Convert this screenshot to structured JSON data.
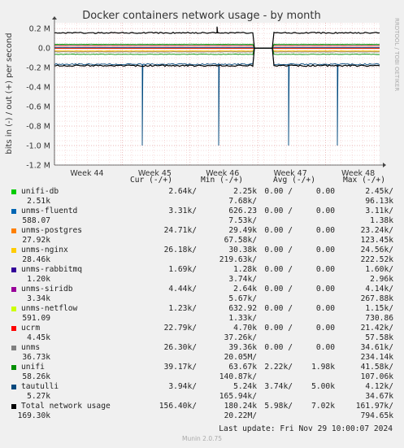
{
  "chart_data": {
    "type": "line",
    "title": "Docker containers network usage - by month",
    "ylabel": "bits in (-) / out (+) per second",
    "side_label": "RRDTOOL / TOBI OETIKER",
    "ylim": [
      -1200000,
      260000
    ],
    "y_ticks": [
      {
        "value": 200000,
        "label": "0.2 M"
      },
      {
        "value": 0,
        "label": "0.0"
      },
      {
        "value": -200000,
        "label": "-0.2 M"
      },
      {
        "value": -400000,
        "label": "-0.4 M"
      },
      {
        "value": -600000,
        "label": "-0.6 M"
      },
      {
        "value": -800000,
        "label": "-0.8 M"
      },
      {
        "value": -1000000,
        "label": "-1.0 M"
      },
      {
        "value": -1200000,
        "label": "-1.2 M"
      }
    ],
    "x_ticks": [
      "Week 44",
      "Week 45",
      "Week 46",
      "Week 47",
      "Week 48"
    ],
    "series": [
      {
        "name": "unifi-db",
        "color": "#00cc00",
        "out_level": 2640,
        "in_level": -2250
      },
      {
        "name": "unms-fluentd",
        "color": "#0066b3",
        "out_level": 3310,
        "in_level": -3310
      },
      {
        "name": "unms-postgres",
        "color": "#ff8000",
        "out_level": 24710,
        "in_level": -29490
      },
      {
        "name": "unms-nginx",
        "color": "#ffcc00",
        "out_level": 26180,
        "in_level": -30380
      },
      {
        "name": "unms-rabbitmq",
        "color": "#330099",
        "out_level": 1690,
        "in_level": -1280
      },
      {
        "name": "unms-siridb",
        "color": "#990099",
        "out_level": 4440,
        "in_level": -2640
      },
      {
        "name": "unms-netflow",
        "color": "#ccff00",
        "out_level": 1230,
        "in_level": -632
      },
      {
        "name": "ucrm",
        "color": "#ff0000",
        "out_level": 22790,
        "in_level": -4700
      },
      {
        "name": "unms",
        "color": "#808080",
        "out_level": 26300,
        "in_level": -39360
      },
      {
        "name": "unifi",
        "color": "#008f00",
        "out_level": 39170,
        "in_level": -63670
      },
      {
        "name": "tautulli",
        "color": "#00487d",
        "out_level": 3940,
        "in_level": -165940
      },
      {
        "name": "Total network usage",
        "color": "#000000",
        "out_level": 156400,
        "in_level": -180240
      }
    ]
  },
  "legend": {
    "headers": {
      "cur": "Cur (-/+)",
      "min": "Min (-/+)",
      "avg": "Avg (-/+)",
      "max": "Max (-/+)"
    },
    "rows": [
      {
        "name": "unifi-db",
        "color": "#00cc00",
        "cur_in": "2.64k/",
        "cur_out": "2.51k",
        "min_in": "2.25k",
        "min_out": "7.68k/",
        "avg_in": "0.00 /",
        "avg_out": "0.00",
        "max_in": "2.45k/",
        "max_out": "96.13k"
      },
      {
        "name": "unms-fluentd",
        "color": "#0066b3",
        "cur_in": "3.31k/",
        "cur_out": "588.07",
        "min_in": "626.23",
        "min_out": "7.53k/",
        "avg_in": "0.00 /",
        "avg_out": "0.00",
        "max_in": "3.11k/",
        "max_out": "1.38k"
      },
      {
        "name": "unms-postgres",
        "color": "#ff8000",
        "cur_in": "24.71k/",
        "cur_out": "27.92k",
        "min_in": "29.49k",
        "min_out": "67.58k/",
        "avg_in": "0.00 /",
        "avg_out": "0.00",
        "max_in": "23.24k/",
        "max_out": "123.45k"
      },
      {
        "name": "unms-nginx",
        "color": "#ffcc00",
        "cur_in": "26.18k/",
        "cur_out": "28.46k",
        "min_in": "30.38k",
        "min_out": "219.63k/",
        "avg_in": "0.00 /",
        "avg_out": "0.00",
        "max_in": "24.56k/",
        "max_out": "222.52k"
      },
      {
        "name": "unms-rabbitmq",
        "color": "#330099",
        "cur_in": "1.69k/",
        "cur_out": "1.20k",
        "min_in": "1.28k",
        "min_out": "3.74k/",
        "avg_in": "0.00 /",
        "avg_out": "0.00",
        "max_in": "1.60k/",
        "max_out": "2.96k"
      },
      {
        "name": "unms-siridb",
        "color": "#990099",
        "cur_in": "4.44k/",
        "cur_out": "3.34k",
        "min_in": "2.64k",
        "min_out": "5.67k/",
        "avg_in": "0.00 /",
        "avg_out": "0.00",
        "max_in": "4.14k/",
        "max_out": "267.88k"
      },
      {
        "name": "unms-netflow",
        "color": "#ccff00",
        "cur_in": "1.23k/",
        "cur_out": "591.09",
        "min_in": "632.92",
        "min_out": "1.33k/",
        "avg_in": "0.00 /",
        "avg_out": "0.00",
        "max_in": "1.15k/",
        "max_out": "730.86"
      },
      {
        "name": "ucrm",
        "color": "#ff0000",
        "cur_in": "22.79k/",
        "cur_out": "4.45k",
        "min_in": "4.70k",
        "min_out": "37.26k/",
        "avg_in": "0.00 /",
        "avg_out": "0.00",
        "max_in": "21.42k/",
        "max_out": "57.58k"
      },
      {
        "name": "unms",
        "color": "#808080",
        "cur_in": "26.30k/",
        "cur_out": "36.73k",
        "min_in": "39.36k",
        "min_out": "20.05M/",
        "avg_in": "0.00 /",
        "avg_out": "0.00",
        "max_in": "34.61k/",
        "max_out": "234.14k"
      },
      {
        "name": "unifi",
        "color": "#008f00",
        "cur_in": "39.17k/",
        "cur_out": "58.26k",
        "min_in": "63.67k",
        "min_out": "140.87k/",
        "avg_in": "2.22k/",
        "avg_out": "1.98k",
        "max_in": "41.58k/",
        "max_out": "107.06k"
      },
      {
        "name": "tautulli",
        "color": "#00487d",
        "cur_in": "3.94k/",
        "cur_out": "5.27k",
        "min_in": "5.24k",
        "min_out": "165.94k/",
        "avg_in": "3.74k/",
        "avg_out": "5.00k",
        "max_in": "4.12k/",
        "max_out": "34.67k"
      },
      {
        "name": "Total network usage",
        "color": "#000000",
        "cur_in": "156.40k/",
        "cur_out": "169.30k",
        "min_in": "180.24k",
        "min_out": "20.22M/",
        "avg_in": "5.98k/",
        "avg_out": "7.02k",
        "max_in": "161.97k/",
        "max_out": "794.65k"
      }
    ]
  },
  "footer": {
    "last_update": "Last update: Fri Nov 29 10:00:07 2024",
    "munin": "Munin 2.0.75"
  }
}
